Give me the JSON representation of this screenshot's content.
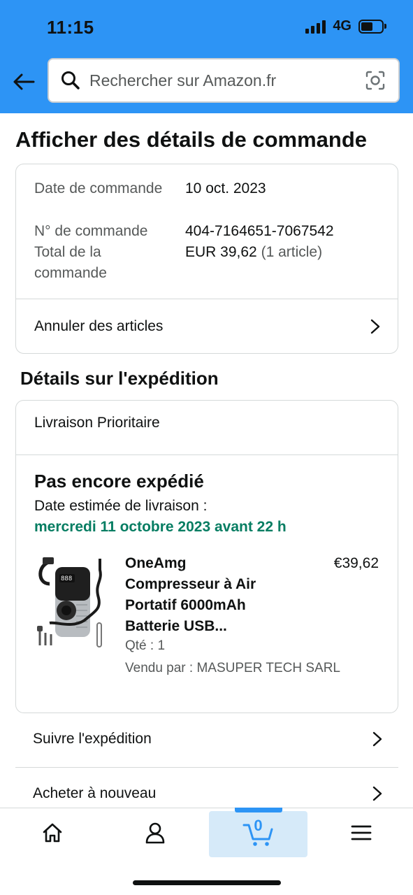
{
  "status_bar": {
    "time": "11:15",
    "network": "4G"
  },
  "search": {
    "placeholder": "Rechercher sur Amazon.fr"
  },
  "page_title": "Afficher des détails de commande",
  "order_summary": {
    "date_label": "Date de commande",
    "date_value": "10 oct. 2023",
    "number_label": "N° de commande",
    "number_value": "404-7164651-7067542",
    "total_label": "Total de la commande",
    "total_value": "EUR 39,62",
    "total_items": "(1 article)",
    "cancel_label": "Annuler des articles"
  },
  "shipping": {
    "section_title": "Détails sur l'expédition",
    "method": "Livraison Prioritaire",
    "status": "Pas encore expédié",
    "estimate_label": "Date estimée de livraison :",
    "estimate_date": "mercredi 11 octobre 2023 avant 22 h"
  },
  "product": {
    "title": "OneAmg Compresseur à Air Portatif 6000mAh Batterie USB...",
    "price": "€39,62",
    "qty": "Qté : 1",
    "seller": "Vendu par : MASUPER TECH SARL"
  },
  "actions": {
    "track_label": "Suivre l'expédition",
    "buy_again_label": "Acheter à nouveau"
  },
  "bottom_nav": {
    "cart_count": "0"
  },
  "colors": {
    "header": "#2d94f5",
    "delivery_green": "#067d62",
    "cart_highlight": "#d6eaf9"
  }
}
